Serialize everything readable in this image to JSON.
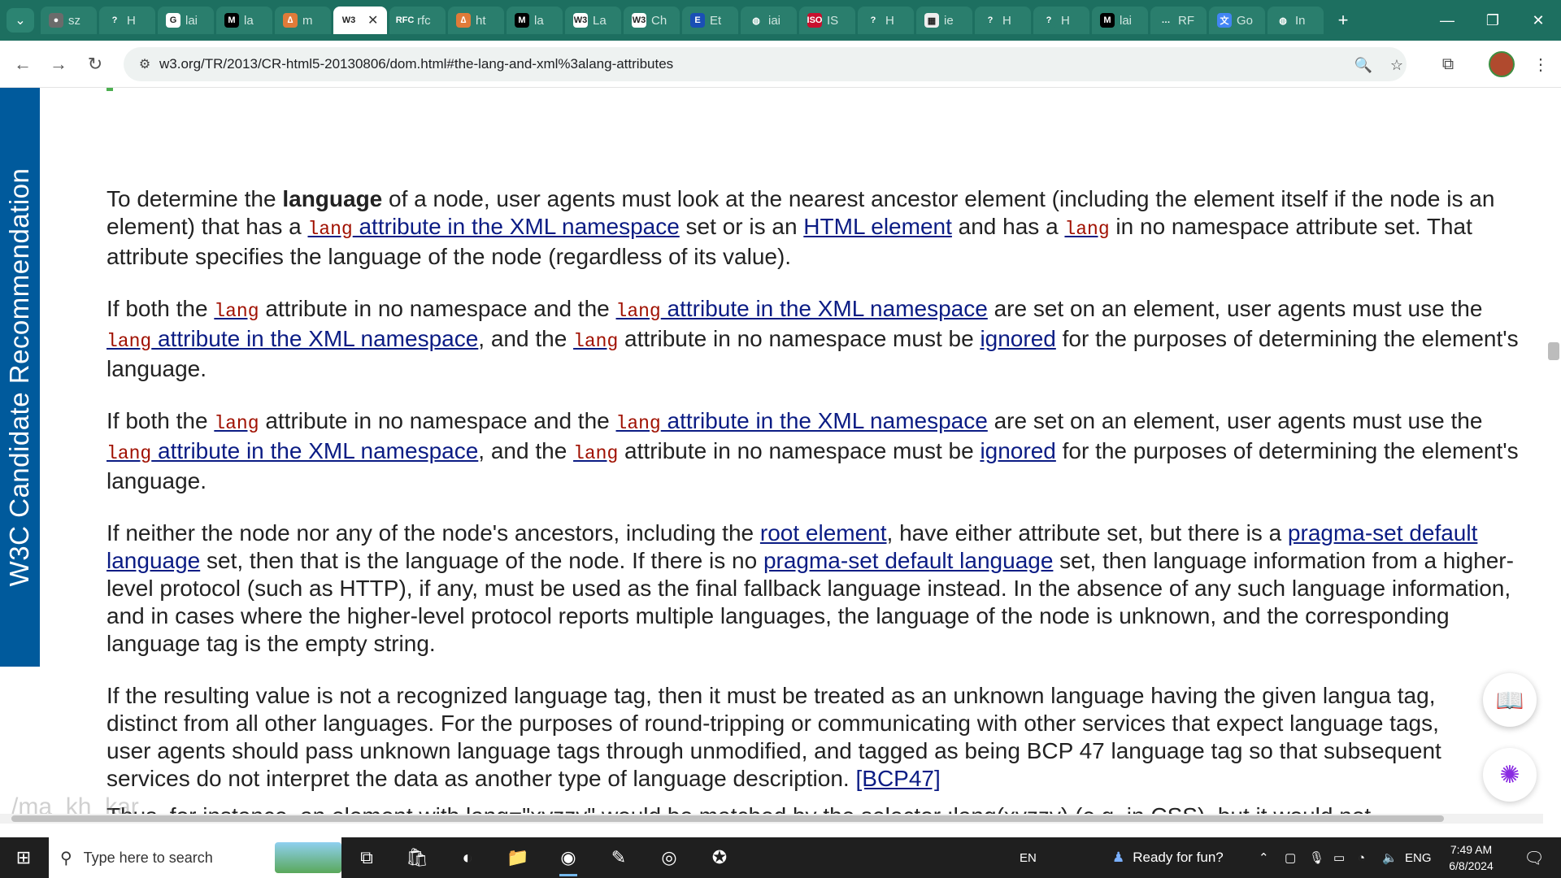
{
  "browser": {
    "tabs": [
      {
        "icon": "openai-icon",
        "label": "sz",
        "fav": "●",
        "fav_bg": "#6b6b6b"
      },
      {
        "icon": "help-icon",
        "label": "H",
        "fav": "?",
        "fav_bg": "#2a7e6d"
      },
      {
        "icon": "google-icon",
        "label": "lai",
        "fav": "G",
        "fav_bg": "#ffffff"
      },
      {
        "icon": "mdn-icon",
        "label": "la",
        "fav": "M",
        "fav_bg": "#000000"
      },
      {
        "icon": "orange-icon",
        "label": "m",
        "fav": "∆",
        "fav_bg": "#e07b39"
      },
      {
        "icon": "w3-icon",
        "label": "",
        "fav": "W3",
        "fav_bg": "#ffffff",
        "active": true
      },
      {
        "icon": "rfc-icon",
        "label": "rfc",
        "fav": "RFC",
        "fav_bg": "#2a7e6d"
      },
      {
        "icon": "orange-icon",
        "label": "ht",
        "fav": "∆",
        "fav_bg": "#e07b39"
      },
      {
        "icon": "mdn-icon",
        "label": "la",
        "fav": "M",
        "fav_bg": "#000000"
      },
      {
        "icon": "w3-icon",
        "label": "La",
        "fav": "W3",
        "fav_bg": "#ffffff"
      },
      {
        "icon": "w3-icon",
        "label": "Ch",
        "fav": "W3",
        "fav_bg": "#ffffff"
      },
      {
        "icon": "e-icon",
        "label": "Et",
        "fav": "E",
        "fav_bg": "#1a4fb5"
      },
      {
        "icon": "globe-icon",
        "label": "iai",
        "fav": "◍",
        "fav_bg": "#2a7e6d"
      },
      {
        "icon": "iso-icon",
        "label": "IS",
        "fav": "ISO",
        "fav_bg": "#c8102e"
      },
      {
        "icon": "help-icon",
        "label": "H",
        "fav": "?",
        "fav_bg": "#2a7e6d"
      },
      {
        "icon": "table-icon",
        "label": "ie",
        "fav": "▦",
        "fav_bg": "#eeeeee"
      },
      {
        "icon": "help-icon",
        "label": "H",
        "fav": "?",
        "fav_bg": "#2a7e6d"
      },
      {
        "icon": "help-icon",
        "label": "H",
        "fav": "?",
        "fav_bg": "#2a7e6d"
      },
      {
        "icon": "mdn-icon",
        "label": "lai",
        "fav": "M",
        "fav_bg": "#000000"
      },
      {
        "icon": "dots-icon",
        "label": "RF",
        "fav": "…",
        "fav_bg": "#2a7e6d"
      },
      {
        "icon": "translate-icon",
        "label": "Go",
        "fav": "文",
        "fav_bg": "#4285f4"
      },
      {
        "icon": "globe-icon",
        "label": "In",
        "fav": "◍",
        "fav_bg": "#2a7e6d"
      }
    ],
    "close_symbol": "✕",
    "new_tab_symbol": "+",
    "url": "w3.org/TR/2013/CR-html5-20130806/dom.html#the-lang-and-xml%3alang-attributes"
  },
  "page": {
    "side_band": "W3C Candidate Recommendation",
    "p1": {
      "t1": "To determine the ",
      "b1": "language",
      "t2": " of a node, user agents must look at the nearest ancestor element (including the element itself if the node is an element) that has a ",
      "c1": "lang",
      "a1": " attribute in the XML namespace",
      "t3": " set or is an ",
      "a2": "HTML element",
      "t4": " and has a ",
      "c2": "lang",
      "t5": " in no namespace attribute set. That attribute specifies the language of the node (regardless of its value)."
    },
    "p2": {
      "t1": "If both the ",
      "c1": "lang",
      "t2": " attribute in no namespace and the ",
      "c2": "lang",
      "a1": " attribute in the XML namespace",
      "t3": " are set on an element, user agents must use the ",
      "c3": "lang",
      "a2": " attribute in the XML namespace",
      "t4": ", and the ",
      "c4": "lang",
      "t5": " attribute in no namespace must be ",
      "a3": "ignored",
      "t6": " for the purposes of determining the element's language."
    },
    "p4": {
      "t1": "If neither the node nor any of the node's ancestors, including the ",
      "a1": "root element",
      "t2": ", have either attribute set, but there is a ",
      "a2": "pragma-set default language",
      "t3": " set, then that is the language of the node. If there is no ",
      "a3": "pragma-set default language",
      "t4": " set, then language information from a higher-level protocol (such as HTTP), if any, must be used as the final fallback language instead. In the absence of any such language information, and in cases where the higher-level protocol reports multiple languages, the language of the node is unknown, and the corresponding language tag is the empty string."
    },
    "p5": {
      "t1": "If the resulting value is not a recognized language tag, then it must be treated as an unknown language having the given langua",
      "t2": "tag, distinct from all other languages. For the purposes of round-tripping or communicating with other services that expect language tags, user agents should pass unknown language tags through unmodified, and tagged as being BCP 47 language tag",
      "t3": "so that subsequent services do not interpret the data as another type of language description. ",
      "a1": "[BCP47]"
    },
    "cutoff_line": "Thus, for instance, an element with lang=\"xyzzy\" would be matched by the selector :lang(xyzzy) (e.g. in CSS), but it would not",
    "watermark": "/ma_kh_kar"
  },
  "taskbar": {
    "search_placeholder": "Type here to search",
    "keyboard_lang": "EN",
    "weather_text": "Ready for fun?",
    "input_lang": "ENG",
    "time": "7:49 AM",
    "date": "6/8/2024"
  },
  "colors": {
    "tabstrip": "#1d6f60",
    "w3c_band": "#005a9c",
    "link": "#0b1c84",
    "code": "#a01000"
  }
}
